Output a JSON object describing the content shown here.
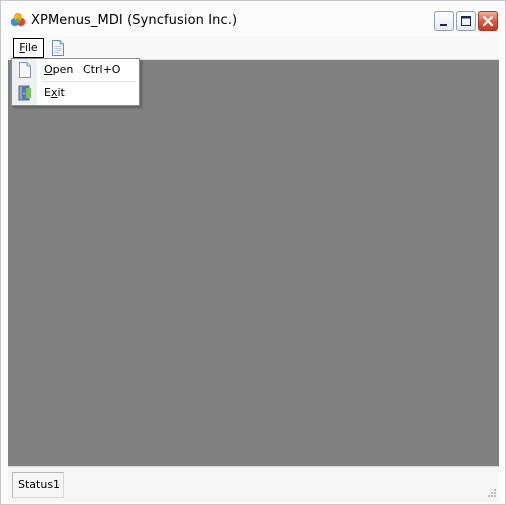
{
  "window": {
    "title": "XPMenus_MDI (Syncfusion Inc.)",
    "app_icon": "syncfusion-logo-icon",
    "controls": [
      "minimize-icon",
      "maximize-icon",
      "close-icon"
    ],
    "colors": {
      "mdi_background": "#808080",
      "close_button": "#d5583d"
    }
  },
  "menubar": {
    "file": {
      "label_first": "F",
      "label_rest": "ile"
    },
    "toolbar_icon": "document-icon"
  },
  "file_menu": {
    "items": [
      {
        "first": "O",
        "rest": "pen",
        "shortcut": "Ctrl+O",
        "icon": "document-icon"
      },
      {
        "first": "E",
        "mid": "x",
        "rest": "it",
        "icon": "exit-door-icon"
      }
    ]
  },
  "statusbar": {
    "panel": "Status1"
  }
}
